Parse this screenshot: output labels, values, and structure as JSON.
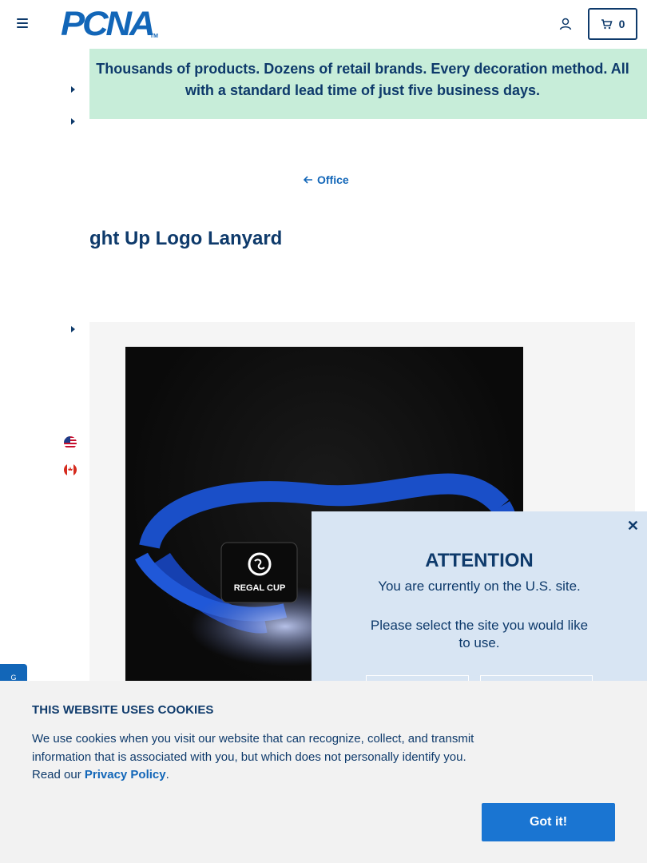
{
  "header": {
    "logo_text": "PCNA",
    "logo_tm": "TM",
    "cart_count": "0"
  },
  "banner": {
    "text": "Thousands of products. Dozens of retail brands. Every decoration method. All with a standard lead time of just five business days."
  },
  "breadcrumb": {
    "label": "Office"
  },
  "product": {
    "title": "ght Up Logo Lanyard",
    "image_brand_text": "REGAL CUP"
  },
  "popup": {
    "title": "ATTENTION",
    "line1": "You are currently on the U.S. site.",
    "line2": "Please select the site you would like to use.",
    "close": "✕"
  },
  "cookie": {
    "title": "THIS WEBSITE USES COOKIES",
    "text_before": "We use cookies when you visit our website that can recognize, collect, and transmit information that is associated with you, but which does not personally identify you. Read our ",
    "link": "Privacy Policy",
    "text_after": ".",
    "button": "Got it!"
  },
  "side_tab": {
    "label": "G"
  },
  "icons": {
    "menu": "hamburger-icon",
    "account": "user-icon",
    "cart": "cart-icon",
    "back": "arrow-left-icon",
    "flag_us": "us-flag-icon",
    "flag_ca": "canada-flag-icon"
  },
  "colors": {
    "brand_blue": "#1266b8",
    "navy": "#0e3a6b",
    "banner_bg": "#c7edd9",
    "popup_bg": "#d8e5f3",
    "cookie_button": "#1a75d2"
  }
}
